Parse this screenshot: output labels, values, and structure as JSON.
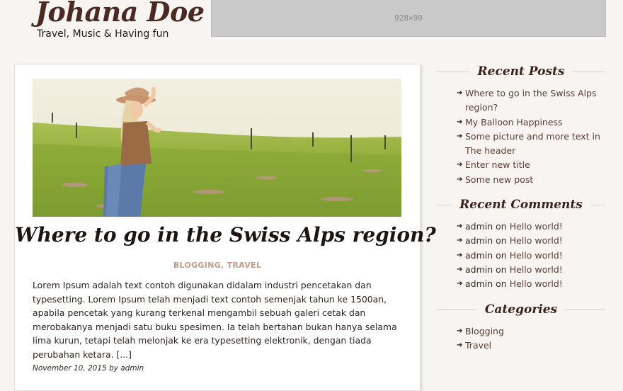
{
  "site": {
    "title": "Johana Doe",
    "tagline": "Travel, Music & Having fun"
  },
  "ad": {
    "label": "928×90"
  },
  "post": {
    "title": "Where to go in the Swiss Alps region?",
    "categories": [
      "BLOGGING",
      "TRAVEL"
    ],
    "separator": ", ",
    "excerpt": "Lorem Ipsum adalah text contoh digunakan didalam industri pencetakan dan typesetting. Lorem Ipsum telah menjadi text contoh semenjak tahun ke 1500an, apabila pencetak yang kurang terkenal mengambil sebuah galeri cetak dan merobakanya menjadi satu buku spesimen. Ia telah bertahan bukan hanya selama lima kurun, tetapi telah melonjak ke era typesetting elektronik, dengan tiada perubahan ketara. [...]",
    "date": "November 10, 2015",
    "by": "by",
    "author": "admin"
  },
  "sidebar": {
    "recent_posts": {
      "title": "Recent Posts",
      "items": [
        "Where to go in the Swiss Alps region?",
        "My Balloon Happiness",
        "Some picture and more text in The header",
        "Enter new title",
        "Some new post"
      ]
    },
    "recent_comments": {
      "title": "Recent Comments",
      "items": [
        {
          "author": "admin",
          "on": "on",
          "post": "Hello world!"
        },
        {
          "author": "admin",
          "on": "on",
          "post": "Hello world!"
        },
        {
          "author": "admin",
          "on": "on",
          "post": "Hello world!"
        },
        {
          "author": "admin",
          "on": "on",
          "post": "Hello world!"
        },
        {
          "author": "admin",
          "on": "on",
          "post": "Hello world!"
        }
      ]
    },
    "categories": {
      "title": "Categories",
      "items": [
        "Blogging",
        "Travel"
      ]
    },
    "arrow_icon": "arrow-right-icon"
  },
  "colors": {
    "background": "#f8f4f1",
    "card": "#ffffff",
    "category_accent": "#c49a86",
    "title_brown": "#4a2a22",
    "ad_gray": "#c9c9c9"
  }
}
